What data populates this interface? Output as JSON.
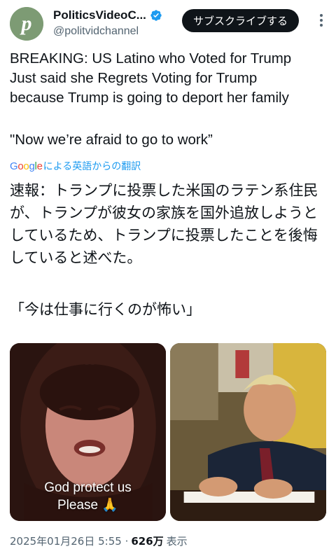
{
  "account": {
    "display_name": "PoliticsVideoC...",
    "handle": "@politvidchannel",
    "avatar_letter": "p",
    "avatar_color": "#7d9b74",
    "verified": true,
    "verified_icon": "verified-badge-icon"
  },
  "header": {
    "subscribe_label": "サブスクライブする",
    "more_icon": "more-vertical-icon"
  },
  "tweet": {
    "lines": [
      "BREAKING: US Latino who Voted for Trump",
      "Just said she Regrets Voting for Trump",
      "because Trump is going to deport her family"
    ],
    "quote": "\"Now we’re afraid to go to work”"
  },
  "translation": {
    "provider_logo": "Google",
    "label": "による英語からの翻訳",
    "text": "速報：トランプに投票した米国のラテン系住民が、トランプが彼女の家族を国外追放しようとしているため、トランプに投票したことを後悔していると述べた。",
    "quote": "「今は仕事に行くのが怖い」"
  },
  "media": {
    "left_caption_line1": "God protect us",
    "left_caption_line2": "Please 🙏"
  },
  "meta": {
    "timestamp": "2025年01月26日 5:55 ·",
    "views": "626万",
    "views_label": "表示"
  },
  "colors": {
    "accent": "#1d9bf0",
    "text_primary": "#0f1419",
    "text_secondary": "#536471"
  }
}
